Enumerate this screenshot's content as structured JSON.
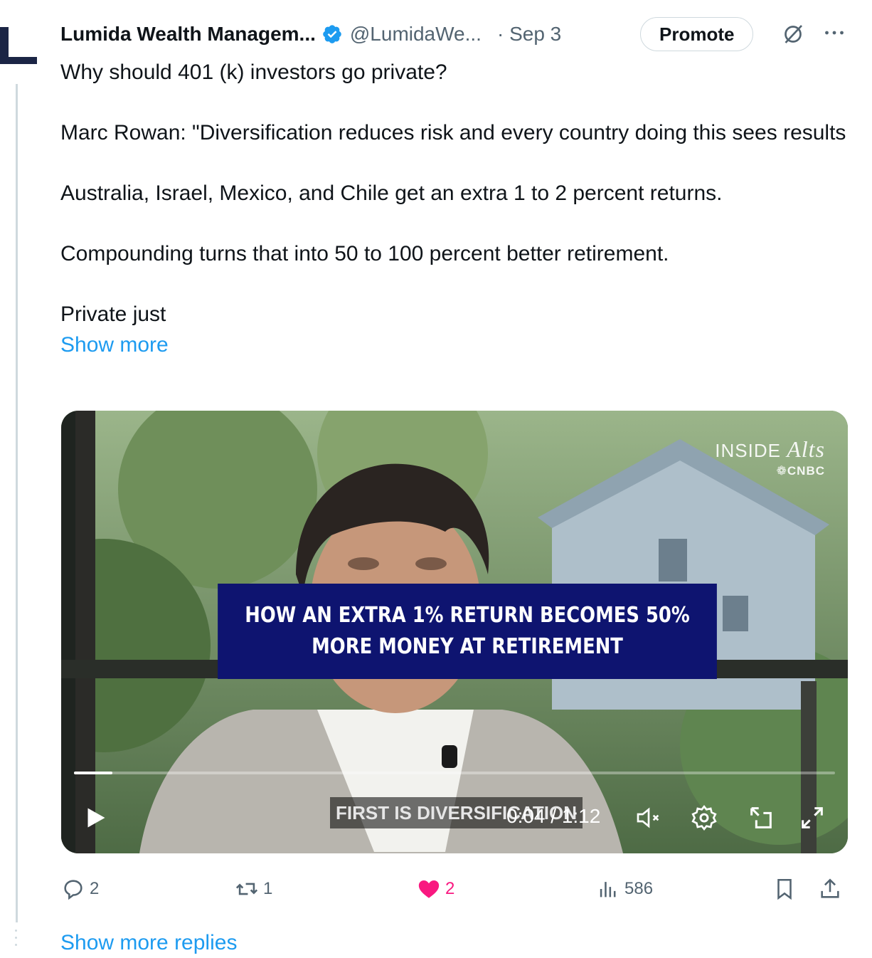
{
  "post": {
    "author_name": "Lumida Wealth Managem...",
    "handle": "@LumidaWe...",
    "separator_date": "· Sep 3",
    "promote_label": "Promote",
    "body": {
      "p1": "Why should 401 (k) investors go private?",
      "p2": "Marc Rowan: \"Diversification reduces risk and every country doing this sees results",
      "p3": "Australia, Israel, Mexico, and Chile get an extra 1 to 2 percent returns.",
      "p4": "Compounding turns that into 50 to 100 percent better retirement.",
      "p5": "Private just",
      "show_more": "Show more"
    }
  },
  "video": {
    "watermark_top_a": "INSIDE ",
    "watermark_top_b": "Alts",
    "watermark_bottom": "CNBC",
    "headline": "HOW AN EXTRA 1% RETURN BECOMES 50% MORE MONEY AT RETIREMENT",
    "caption": "FIRST IS DIVERSIFICATION",
    "time_current": "0:04",
    "time_total": "1:12",
    "timecode": "0:04 / 1:12",
    "progress_fraction": 0.05,
    "icons": [
      "play-icon",
      "mute-icon",
      "settings-icon",
      "pip-icon",
      "fullscreen-icon"
    ]
  },
  "actions": {
    "replies": "2",
    "reposts": "1",
    "likes": "2",
    "views": "586",
    "liked": true,
    "like_color": "#f91880"
  },
  "thread": {
    "show_more_replies": "Show more replies"
  },
  "colors": {
    "link": "#1d9bf0",
    "muted": "#536471",
    "headline_bg": "#0e1470"
  }
}
